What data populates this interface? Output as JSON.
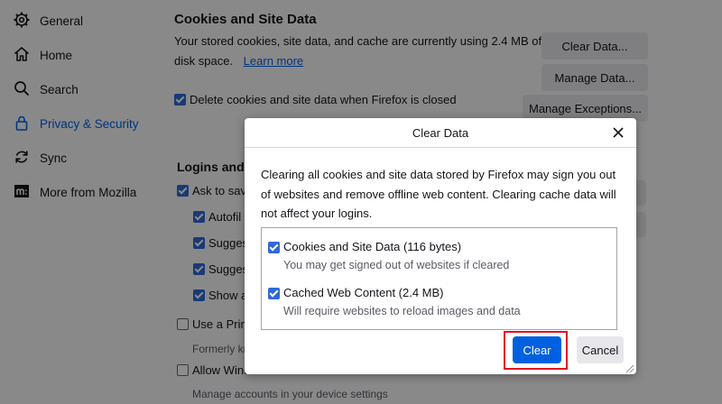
{
  "sidebar": {
    "items": [
      {
        "label": "General",
        "icon": "gear-icon"
      },
      {
        "label": "Home",
        "icon": "home-icon"
      },
      {
        "label": "Search",
        "icon": "search-icon"
      },
      {
        "label": "Privacy & Security",
        "icon": "lock-icon",
        "active": true
      },
      {
        "label": "Sync",
        "icon": "sync-icon"
      },
      {
        "label": "More from Mozilla",
        "icon": "mozilla-icon"
      }
    ]
  },
  "cookies": {
    "heading": "Cookies and Site Data",
    "desc_line1": "Your stored cookies, site data, and cache are currently using 2.4 MB of",
    "desc_line2": "disk space.",
    "learn_more": "Learn more",
    "delete_on_close": "Delete cookies and site data when Firefox is closed",
    "clear_data_btn": "Clear Data...",
    "manage_data_btn": "Manage Data...",
    "manage_exceptions_btn": "Manage Exceptions..."
  },
  "logins": {
    "heading_partial": "Logins and P",
    "ask_to_save": "Ask to save",
    "autofill": "Autofil",
    "suggest1": "Sugges",
    "suggest2": "Sugges",
    "show_alerts": "Show a",
    "use_primary": "Use a Prima",
    "formerly": "Formerly kn",
    "allow_windows": "Allow Wind",
    "manage_accounts": "Manage accounts in your device settings"
  },
  "dialog": {
    "title": "Clear Data",
    "description": "Clearing all cookies and site data stored by Firefox may sign you out of websites and remove offline web content. Clearing cache data will not affect your logins.",
    "option1_label": "Cookies and Site Data (116 bytes)",
    "option1_sub": "You may get signed out of websites if cleared",
    "option2_label": "Cached Web Content (2.4 MB)",
    "option2_sub": "Will require websites to reload images and data",
    "clear_btn": "Clear",
    "cancel_btn": "Cancel"
  },
  "colors": {
    "accent": "#0061e0",
    "highlight": "#e0131f"
  }
}
